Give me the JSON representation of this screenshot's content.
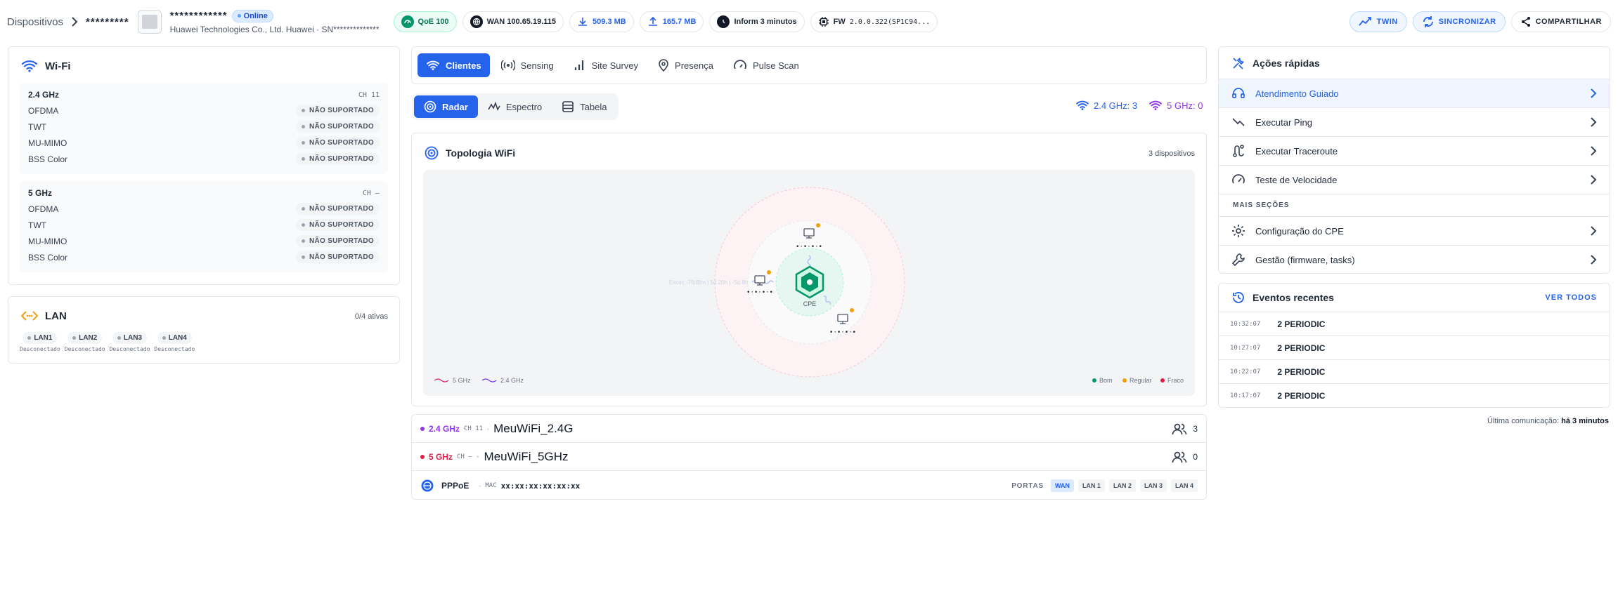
{
  "breadcrumb": {
    "root": "Dispositivos",
    "device": "*********"
  },
  "device": {
    "serial": "************",
    "status": "Online",
    "manufacturer_line": "Huawei Technologies Co., Ltd. Huawei · SN**************"
  },
  "chips": {
    "qoe": "QoE 100",
    "wan": "WAN 100.65.19.115",
    "download": "509.3 MB",
    "upload": "165.7 MB",
    "inform": "Inform 3 minutos",
    "fw_label": "FW",
    "fw_value": "2.0.0.322(SP1C94..."
  },
  "header_buttons": {
    "twin": "TWIN",
    "sync": "SINCRONIZAR",
    "share": "COMPARTILHAR"
  },
  "wifi": {
    "title": "Wi-Fi",
    "bands": [
      {
        "name": "2.4 GHz",
        "ch": "CH  11",
        "features": [
          {
            "label": "OFDMA",
            "status": "NÃO SUPORTADO"
          },
          {
            "label": "TWT",
            "status": "NÃO SUPORTADO"
          },
          {
            "label": "MU-MIMO",
            "status": "NÃO SUPORTADO"
          },
          {
            "label": "BSS Color",
            "status": "NÃO SUPORTADO"
          }
        ]
      },
      {
        "name": "5 GHz",
        "ch": "CH  –",
        "features": [
          {
            "label": "OFDMA",
            "status": "NÃO SUPORTADO"
          },
          {
            "label": "TWT",
            "status": "NÃO SUPORTADO"
          },
          {
            "label": "MU-MIMO",
            "status": "NÃO SUPORTADO"
          },
          {
            "label": "BSS Color",
            "status": "NÃO SUPORTADO"
          }
        ]
      }
    ]
  },
  "lan": {
    "title": "LAN",
    "active": "0/4 ativas",
    "ports": [
      {
        "name": "LAN1",
        "status": "Desconectado"
      },
      {
        "name": "LAN2",
        "status": "Desconectado"
      },
      {
        "name": "LAN3",
        "status": "Desconectado"
      },
      {
        "name": "LAN4",
        "status": "Desconectado"
      }
    ]
  },
  "tabs": [
    "Clientes",
    "Sensing",
    "Site Survey",
    "Presença",
    "Pulse Scan"
  ],
  "subtabs": [
    "Radar",
    "Espectro",
    "Tabela"
  ],
  "band_counts": {
    "g24": "2.4 GHz: 3",
    "g5": "5 GHz: 0"
  },
  "topology": {
    "title": "Topologia WiFi",
    "count": "3 dispositivos",
    "center_label": "CPE",
    "device_labels": [
      "•·•·•·•",
      "•·•·•·•",
      "•·•·•·•"
    ],
    "legend_bands": [
      "5 GHz",
      "2.4 GHz"
    ],
    "legend_quality": [
      "Bom",
      "Regular",
      "Fraco"
    ],
    "faint_text": "Excel: -76dBm | 5d 20h | -5d 8h"
  },
  "ssids": [
    {
      "band": "2.4 GHz",
      "ch": "CH  11",
      "name": "MeuWiFi_2.4G",
      "clients": "3"
    },
    {
      "band": "5 GHz",
      "ch": "CH  –  -",
      "name": "MeuWiFi_5GHz",
      "clients": "0"
    }
  ],
  "pppoe": {
    "label": "PPPoE",
    "mac_label": "MAC",
    "mac": "xx:xx:xx:xx:xx:xx",
    "ports_label": "PORTAS",
    "ports": [
      "WAN",
      "LAN 1",
      "LAN 2",
      "LAN 3",
      "LAN 4"
    ]
  },
  "quick_actions": {
    "title": "Ações rápidas",
    "items": [
      "Atendimento Guiado",
      "Executar Ping",
      "Executar Traceroute",
      "Teste de Velocidade"
    ],
    "more_title": "MAIS SEÇÕES",
    "more_items": [
      "Configuração do CPE",
      "Gestão (firmware, tasks)"
    ]
  },
  "events": {
    "title": "Eventos recentes",
    "view_all": "VER TODOS",
    "items": [
      {
        "time": "10:32:07",
        "name": "2 PERIODIC"
      },
      {
        "time": "10:27:07",
        "name": "2 PERIODIC"
      },
      {
        "time": "10:22:07",
        "name": "2 PERIODIC"
      },
      {
        "time": "10:17:07",
        "name": "2 PERIODIC"
      }
    ]
  },
  "last_comm": {
    "label": "Última comunicação:",
    "value": "há 3 minutos"
  },
  "colors": {
    "primary": "#2563eb",
    "good": "#059669",
    "regular": "#f59e0b",
    "weak": "#e11d48",
    "band5": "#db2777",
    "band24": "#7c3aed"
  }
}
